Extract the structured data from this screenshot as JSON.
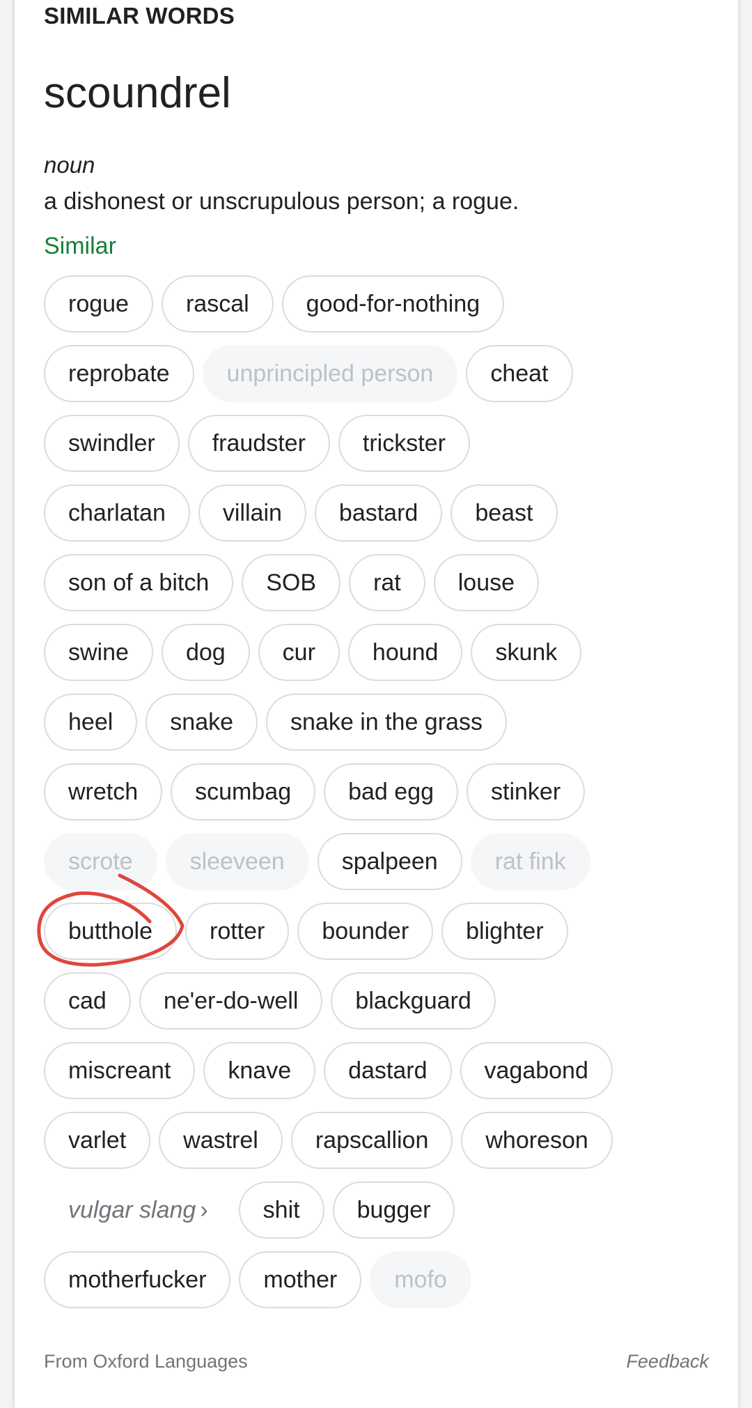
{
  "section_title": "SIMILAR WORDS",
  "headword": "scoundrel",
  "part_of_speech": "noun",
  "definition": "a dishonest or unscrupulous person; a rogue.",
  "similar_label": "Similar",
  "colors": {
    "similar_label": "#188038",
    "annotation": "#e0463c",
    "chip_border": "#dadce0",
    "chip_muted_bg": "#f5f6f8",
    "chip_muted_text": "#bdc1c6"
  },
  "chip_rows": [
    [
      {
        "label": "rogue"
      },
      {
        "label": "rascal"
      },
      {
        "label": "good-for-nothing"
      }
    ],
    [
      {
        "label": "reprobate"
      },
      {
        "label": "unprincipled person",
        "muted": true
      },
      {
        "label": "cheat"
      }
    ],
    [
      {
        "label": "swindler"
      },
      {
        "label": "fraudster"
      },
      {
        "label": "trickster"
      }
    ],
    [
      {
        "label": "charlatan"
      },
      {
        "label": "villain"
      },
      {
        "label": "bastard"
      },
      {
        "label": "beast"
      }
    ],
    [
      {
        "label": "son of a bitch"
      },
      {
        "label": "SOB"
      },
      {
        "label": "rat"
      },
      {
        "label": "louse"
      }
    ],
    [
      {
        "label": "swine"
      },
      {
        "label": "dog"
      },
      {
        "label": "cur"
      },
      {
        "label": "hound"
      },
      {
        "label": "skunk"
      }
    ],
    [
      {
        "label": "heel"
      },
      {
        "label": "snake"
      },
      {
        "label": "snake in the grass"
      }
    ],
    [
      {
        "label": "wretch"
      },
      {
        "label": "scumbag"
      },
      {
        "label": "bad egg"
      },
      {
        "label": "stinker"
      }
    ],
    [
      {
        "label": "scrote",
        "muted": true
      },
      {
        "label": "sleeveen",
        "muted": true
      },
      {
        "label": "spalpeen"
      },
      {
        "label": "rat fink",
        "muted": true
      }
    ],
    [
      {
        "label": "butthole",
        "circled": true
      },
      {
        "label": "rotter"
      },
      {
        "label": "bounder"
      },
      {
        "label": "blighter"
      }
    ],
    [
      {
        "label": "cad"
      },
      {
        "label": "ne'er-do-well"
      },
      {
        "label": "blackguard"
      }
    ],
    [
      {
        "label": "miscreant"
      },
      {
        "label": "knave"
      },
      {
        "label": "dastard"
      },
      {
        "label": "vagabond"
      }
    ],
    [
      {
        "label": "varlet"
      },
      {
        "label": "wastrel"
      },
      {
        "label": "rapscallion"
      },
      {
        "label": "whoreson"
      }
    ],
    [
      {
        "label": "vulgar slang",
        "register": true
      },
      {
        "label": "shit"
      },
      {
        "label": "bugger"
      }
    ],
    [
      {
        "label": "motherfucker"
      },
      {
        "label": "mother"
      },
      {
        "label": "mofo",
        "muted": true
      }
    ]
  ],
  "footer": {
    "source": "From Oxford Languages",
    "feedback": "Feedback"
  }
}
